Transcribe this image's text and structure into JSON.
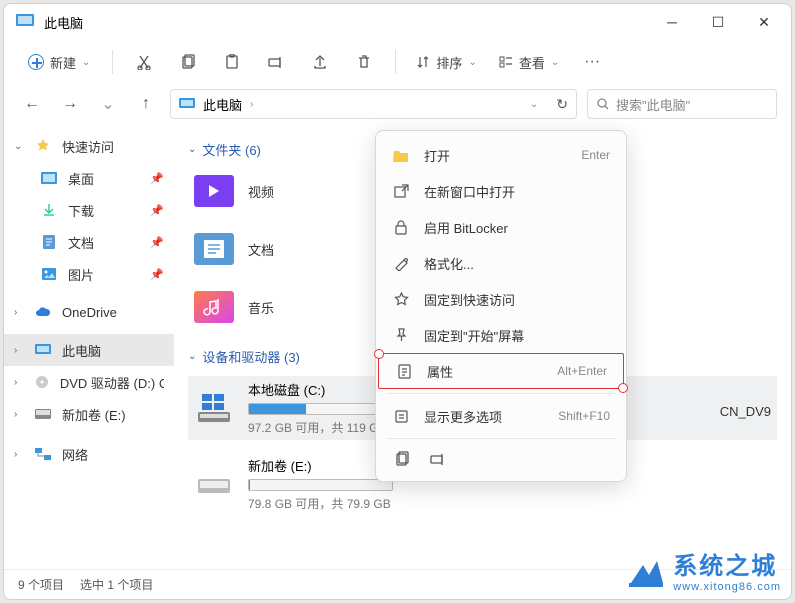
{
  "title": "此电脑",
  "toolbar": {
    "new_label": "新建",
    "sort_label": "排序",
    "view_label": "查看"
  },
  "addr": {
    "location": "此电脑"
  },
  "search": {
    "placeholder": "搜索\"此电脑\""
  },
  "sidebar": {
    "quick": "快速访问",
    "items": [
      "桌面",
      "下载",
      "文档",
      "图片"
    ],
    "onedrive": "OneDrive",
    "thispc": "此电脑",
    "dvd": "DVD 驱动器 (D:) C(",
    "newvol": "新加卷 (E:)",
    "network": "网络"
  },
  "content": {
    "folders_header": "文件夹 (6)",
    "folders": [
      "视频",
      "文档",
      "音乐"
    ],
    "devices_header": "设备和驱动器 (3)",
    "drives": [
      {
        "name": "本地磁盘 (C:)",
        "fill_pct": 40,
        "sub": "97.2 GB 可用，共 119 G"
      },
      {
        "name": "新加卷 (E:)",
        "fill_pct": 1,
        "sub": "79.8 GB 可用，共 79.9 GB"
      }
    ],
    "extra_right": "CN_DV9"
  },
  "context_menu": {
    "items": [
      {
        "label": "打开",
        "shortcut": "Enter"
      },
      {
        "label": "在新窗口中打开",
        "shortcut": ""
      },
      {
        "label": "启用 BitLocker",
        "shortcut": ""
      },
      {
        "label": "格式化...",
        "shortcut": ""
      },
      {
        "label": "固定到快速访问",
        "shortcut": ""
      },
      {
        "label": "固定到\"开始\"屏幕",
        "shortcut": ""
      },
      {
        "label": "属性",
        "shortcut": "Alt+Enter",
        "highlighted": true
      },
      {
        "label": "显示更多选项",
        "shortcut": "Shift+F10"
      }
    ]
  },
  "status": {
    "count": "9 个项目",
    "selected": "选中 1 个项目"
  },
  "watermark": {
    "text": "系统之城",
    "url": "www.xitong86.com"
  }
}
